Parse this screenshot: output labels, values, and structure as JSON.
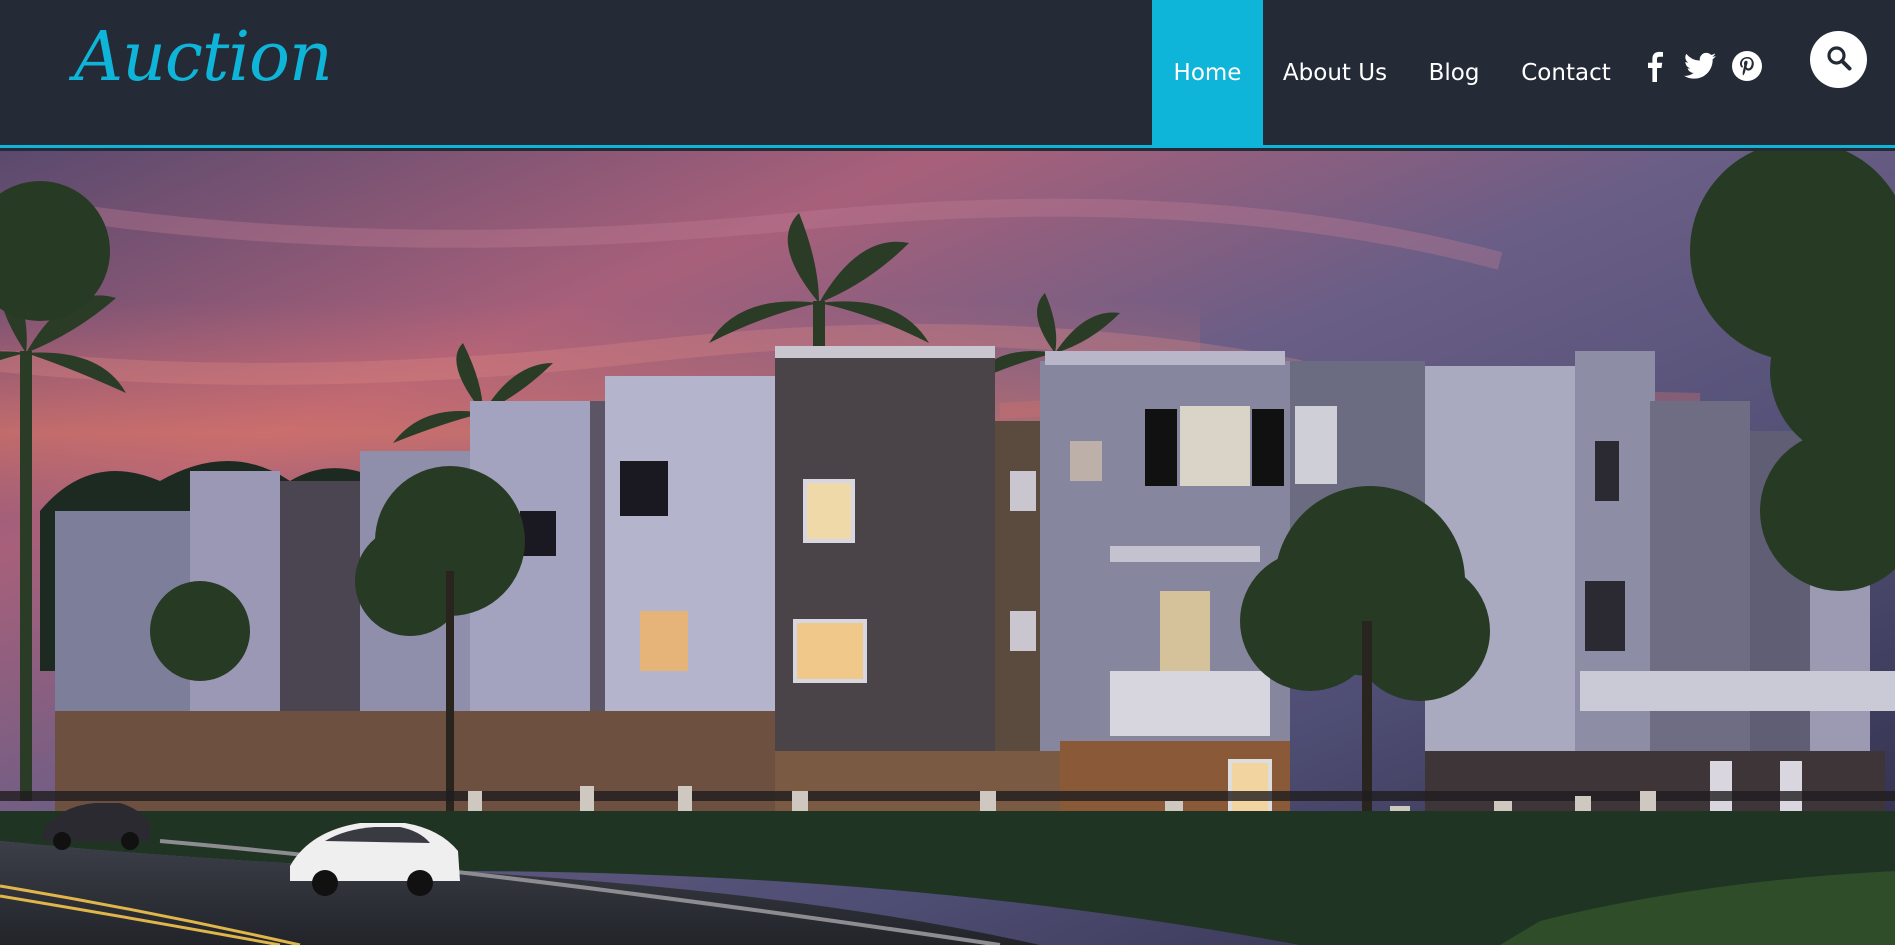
{
  "brand": {
    "logo_text": "Auction"
  },
  "nav": {
    "items": [
      {
        "label": "Home",
        "active": true
      },
      {
        "label": "About Us",
        "active": false
      },
      {
        "label": "Blog",
        "active": false
      },
      {
        "label": "Contact",
        "active": false
      }
    ]
  },
  "social": [
    {
      "icon": "facebook-icon"
    },
    {
      "icon": "twitter-icon"
    },
    {
      "icon": "pinterest-icon"
    }
  ],
  "search": {
    "icon": "search-icon"
  },
  "hero": {
    "image": "townhouses-at-dusk-photo"
  },
  "colors": {
    "header_bg": "#242b36",
    "accent": "#0fb4d9",
    "nav_text": "#ffffff"
  }
}
